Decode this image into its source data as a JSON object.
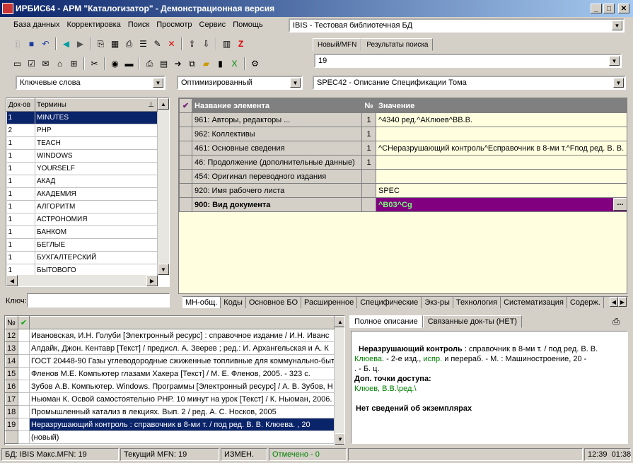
{
  "window": {
    "title": "ИРБИС64 - АРМ \"Каталогизатор\" - Демонстрационная версия"
  },
  "menu": [
    "База данных",
    "Корректировка",
    "Поиск",
    "Просмотр",
    "Сервис",
    "Помощь"
  ],
  "db_combo": "IBIS - Тестовая библиотечная БД",
  "tabs_top": [
    "Новый/MFN",
    "Результаты поиска"
  ],
  "mfn_value": "19",
  "search_combo": "Ключевые слова",
  "mode_combo": "Оптимизированный",
  "ws_combo": "SPEC42 - Описание Спецификации Тома",
  "terms": {
    "headers": [
      "Док-ов",
      "Термины"
    ],
    "rows": [
      [
        "1",
        "MINUTES"
      ],
      [
        "2",
        "PHP"
      ],
      [
        "1",
        "TEACH"
      ],
      [
        "1",
        "WINDOWS"
      ],
      [
        "1",
        "YOURSELF"
      ],
      [
        "1",
        "АКАД"
      ],
      [
        "1",
        "АКАДЕМИЯ"
      ],
      [
        "1",
        "АЛГОРИТМ"
      ],
      [
        "1",
        "АСТРОНОМИЯ"
      ],
      [
        "1",
        "БАНКОМ"
      ],
      [
        "1",
        "БЕГЛЫЕ"
      ],
      [
        "1",
        "БУХГАЛТЕРСКИЙ"
      ],
      [
        "1",
        "БЫТОВОГО"
      ]
    ]
  },
  "key_label": "Ключ:",
  "fields": {
    "headers": [
      "Название элемента",
      "№",
      "Значение"
    ],
    "rows": [
      {
        "name": "961: Авторы, редакторы ...",
        "no": "1",
        "value": "^4340 ред.^AКлюев^BВ.В."
      },
      {
        "name": "962: Коллективы",
        "no": "1",
        "value": ""
      },
      {
        "name": "461: Основные сведения",
        "no": "1",
        "value": "^CНеразрушающий контроль^Eсправочник в 8-ми т.^Fпод ред. В. В. К"
      },
      {
        "name": "46: Продолжение (дополнительные данные)",
        "no": "1",
        "value": ""
      },
      {
        "name": "454: Оригинал переводного издания",
        "no": "",
        "value": ""
      },
      {
        "name": "920: Имя рабочего листа",
        "no": "",
        "value": "SPEC"
      },
      {
        "name": "900: Вид документа",
        "no": "",
        "value": "^B03^Cg"
      }
    ],
    "edit_button": "..."
  },
  "bottom_tabs": [
    "МН-общ.",
    "Коды",
    "Основное БО",
    "Расширенное",
    "Специфические",
    "Экз-ры",
    "Технология",
    "Систематизация",
    "Содерж."
  ],
  "docs": {
    "headers": [
      "№",
      ""
    ],
    "rows": [
      [
        "12",
        "Ивановская, И.Н. Голуби [Электронный ресурс] : справочное издание / И.Н. Иванс"
      ],
      [
        "13",
        "Алдайк, Джон. Кентавр [Текст] / предисл. А. Зверев ; ред.: И. Архангельская и А. К"
      ],
      [
        "14",
        "ГОСТ 20448-90 Газы углеводородные сжиженные топливные для коммунально-быт"
      ],
      [
        "15",
        "Фленов М.Е. Компьютер глазами Хакера [Текст] / М. Е. Фленов, 2005. - 323 с."
      ],
      [
        "16",
        "Зубов А.В. Компьютер. Windows. Программы [Электронный ресурс] / А. В. Зубов, Н"
      ],
      [
        "17",
        "Ньюман К. Освой самостоятельно PHP. 10 минут на урок [Текст] / К. Ньюман, 2006."
      ],
      [
        "18",
        "Промышленный катализ в лекциях. Вып. 2 / ред. А. С. Носков, 2005"
      ],
      [
        "19",
        "Неразрушающий контроль : справочник в 8-ми т. / под ред. В. В. Клюева. , 20"
      ],
      [
        "",
        "(новый)"
      ]
    ]
  },
  "desc_tabs": [
    "Полное описание",
    "Связанные док-ты (НЕТ)"
  ],
  "desc": {
    "l1_bold": "Неразрушающий контроль",
    "l1_rest": " : справочник в 8-ми т. / под ред. В. В.",
    "l2_g1": "Клюева",
    "l2_t1": ". - 2-е изд., ",
    "l2_g2": "испр.",
    "l2_t2": " и перераб. - М. : Машиностроение, 20 -",
    "l3": ". - Б. ц.",
    "l4": "Доп. точки доступа:",
    "l5": "Клюев, В.В.\\ред.\\",
    "l6": "Нет сведений об экземплярах"
  },
  "status": {
    "db": "БД: IBIS Макс.MFN: 19",
    "cur": "Текущий MFN: 19",
    "changed": "ИЗМЕН.",
    "marked": "Отмечено - 0",
    "time": "12:39",
    "time2": "01:38"
  },
  "colors": {
    "title_bg": "#0a246a",
    "selection": "#0a246a",
    "field_bg": "#ffffe0",
    "vid_bg": "#800080"
  }
}
